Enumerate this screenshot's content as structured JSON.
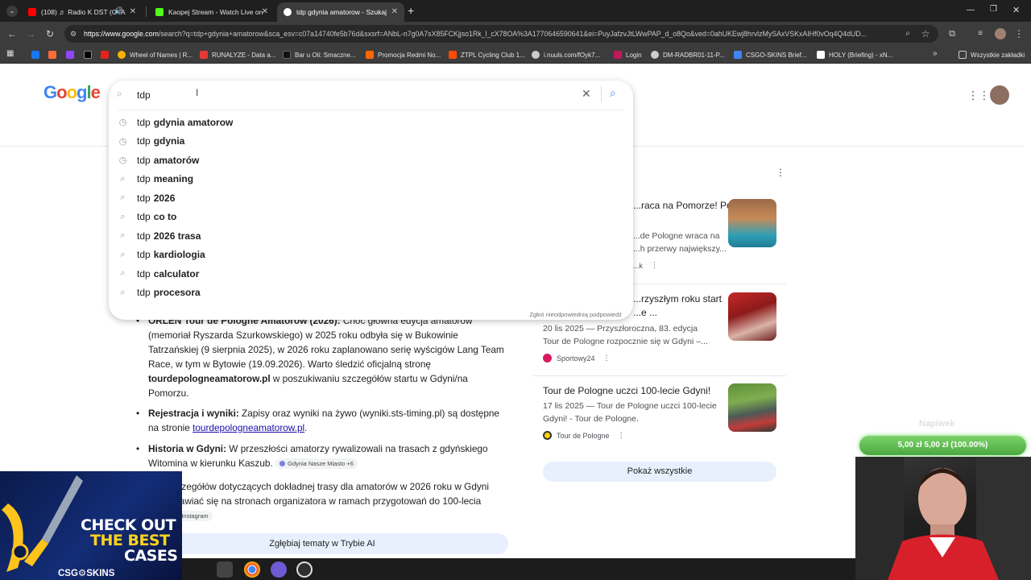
{
  "browser": {
    "tabs": [
      {
        "label": "(108) ♬ Radio K DST (GTA",
        "color": "#ff0000"
      },
      {
        "label": "Kaopej Stream - Watch Live on",
        "color": "#53fc18"
      },
      {
        "label": "tdp gdynia amatorow - Szukaj",
        "color": "#4285f4"
      }
    ],
    "new_tab_label": "+",
    "url_host": "https://www.google.com",
    "url_rest": "/search?q=tdp+gdynia+amatorow&sca_esv=c07a14740fe5b76d&sxsrf=ANbL-n7g0A7sX85FCKjjso1Rk_l_cX78OA%3A1770646590641&ei=PuyJafzvJtLWwPAP_d_o8Qo&ved=0ahUKEwj8hrvlzMySAxVSKxAIHf0vOq4Q4dUD...",
    "bookmarks": [
      {
        "label": "",
        "color": "#1877f2"
      },
      {
        "label": "",
        "color": "#ff6b35"
      },
      {
        "label": "",
        "color": "#9146ff"
      },
      {
        "label": "",
        "color": "#000000"
      },
      {
        "label": "",
        "color": "#e62117"
      },
      {
        "label": "Wheel of Names | R...",
        "color": "#f4b400"
      },
      {
        "label": "RUNALYZE - Data a...",
        "color": "#e53935"
      },
      {
        "label": "Bar u Oli: Smaczne...",
        "color": "#111111"
      },
      {
        "label": "Promocja Redmi No...",
        "color": "#ff6700"
      },
      {
        "label": "ZTPL Cycling Club 1...",
        "color": "#fc4c02"
      },
      {
        "label": "i.nuuls.com/fOyk7...",
        "color": "#cccccc"
      },
      {
        "label": "Login",
        "color": "#c2185b"
      },
      {
        "label": "DM-RADBR01-11-P...",
        "color": "#cccccc"
      },
      {
        "label": "CSGO-SKINS Brief...",
        "color": "#4285f4"
      },
      {
        "label": "HOLY (Briefing) - xN...",
        "color": "#ffffff"
      }
    ],
    "all_bookmarks_label": "Wszystkie zakładki"
  },
  "search": {
    "value": "tdp",
    "logo_text": "Google",
    "suggestions": [
      {
        "prefix": "tdp",
        "bold": "gdynia amatorow",
        "icon": "history-icon"
      },
      {
        "prefix": "tdp",
        "bold": "gdynia",
        "icon": "history-icon"
      },
      {
        "prefix": "tdp",
        "bold": "amatorów",
        "icon": "history-icon"
      },
      {
        "prefix": "tdp",
        "bold": "meaning",
        "icon": "search-icon"
      },
      {
        "prefix": "tdp",
        "bold": "2026",
        "icon": "search-icon"
      },
      {
        "prefix": "tdp",
        "bold": "co to",
        "icon": "search-icon"
      },
      {
        "prefix": "tdp",
        "bold": "2026 trasa",
        "icon": "search-icon"
      },
      {
        "prefix": "tdp",
        "bold": "kardiologia",
        "icon": "search-icon"
      },
      {
        "prefix": "tdp",
        "bold": "calculator",
        "icon": "search-icon"
      },
      {
        "prefix": "tdp",
        "bold": "procesora",
        "icon": "search-icon"
      }
    ],
    "report_label": "Zgłoś nieodpowiednią podpowiedź"
  },
  "ai_overview": {
    "b1_title": "ORLEN Tour de Pologne Amatorów (2026):",
    "b1_text": " Choć główna edycja amatorów (memoriał Ryszarda Szurkowskiego) w 2025 roku odbyła się w Bukowinie Tatrzańskiej (9 sierpnia 2025), w 2026 roku zaplanowano serię wyścigów Lang Team Race, w tym w Bytowie (19.09.2026). Warto śledzić oficjalną stronę ",
    "b1_bold2": "tourdepolognea matorow.pl",
    "b1_tail": " w poszukiwaniu szczegółów startu w Gdyni/na Pomorzu.",
    "b2_title": "Rejestracja i wyniki:",
    "b2_text": " Zapisy oraz wyniki na żywo (wyniki.sts-timing.pl) są dostępne na stronie ",
    "b2_link": "tourdepologneamatorow.pl",
    "b2_tail": ".",
    "b3_title": "Historia w Gdyni:",
    "b3_text": " W przeszłości amatorzy rywalizowali na trasach z gdyńskiego Witomina w kierunku Kaszub.",
    "b3_chip": "Gdynia Nasze Miasto +6",
    "para": "Więcej szczegółów dotyczących dokładnej trasy dla amatorów w 2026 roku w Gdyni będzie pojawiać się na stronach organizatora w ramach przygotowań do 100-lecia miasta.",
    "para_chip": "Instagram",
    "deep_dive": "Zgłębiaj tematy w Trybie AI"
  },
  "news": [
    {
      "title": "...raca na Pomorze! Po 12",
      "desc": "...de Pologne wraca na\n...h przerwy największy...",
      "source": "...k"
    },
    {
      "title": "...rzyszłym roku start\n...e ...",
      "desc": "20 lis 2025 — Przyszłoroczna, 83. edycja\nTour de Pologne rozpocznie się w Gdyni –...",
      "source": "Sportowy24"
    },
    {
      "title": "Tour de Pologne uczci 100-lecie Gdyni!",
      "desc": "17 lis 2025 — Tour de Pologne uczci 100-lecie\nGdyni! - Tour de Pologne.",
      "source": "Tour de Pologne"
    }
  ],
  "show_all": "Pokaż wszystkie",
  "stream": {
    "tip_ghost": "Napiwek",
    "tip_progress": "5,00 zł  5,00 zł (100.00%)",
    "tip_fraction": 1.0
  },
  "ad": {
    "line1": "CHECK OUT",
    "line2": "THE BEST",
    "line3": "CASES",
    "brand": "CSG⚙SKINS"
  },
  "colors": {
    "accent_blue": "#1a0dab",
    "chip_bg": "#e8f0fe"
  }
}
